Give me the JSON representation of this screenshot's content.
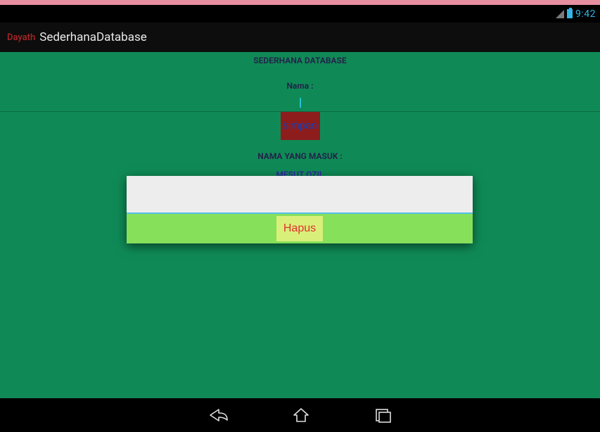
{
  "status": {
    "clock": "9:42"
  },
  "actionbar": {
    "brand": "Dayath",
    "title": "SederhanaDatabase"
  },
  "main": {
    "heading": "SEDERHANA DATABASE",
    "name_label": "Nama :",
    "name_value": "",
    "save_button": "simpan",
    "list_heading": "NAMA YANG MASUK :",
    "record0": "MESUT OZIL"
  },
  "dialog": {
    "delete_button": "Hapus"
  }
}
